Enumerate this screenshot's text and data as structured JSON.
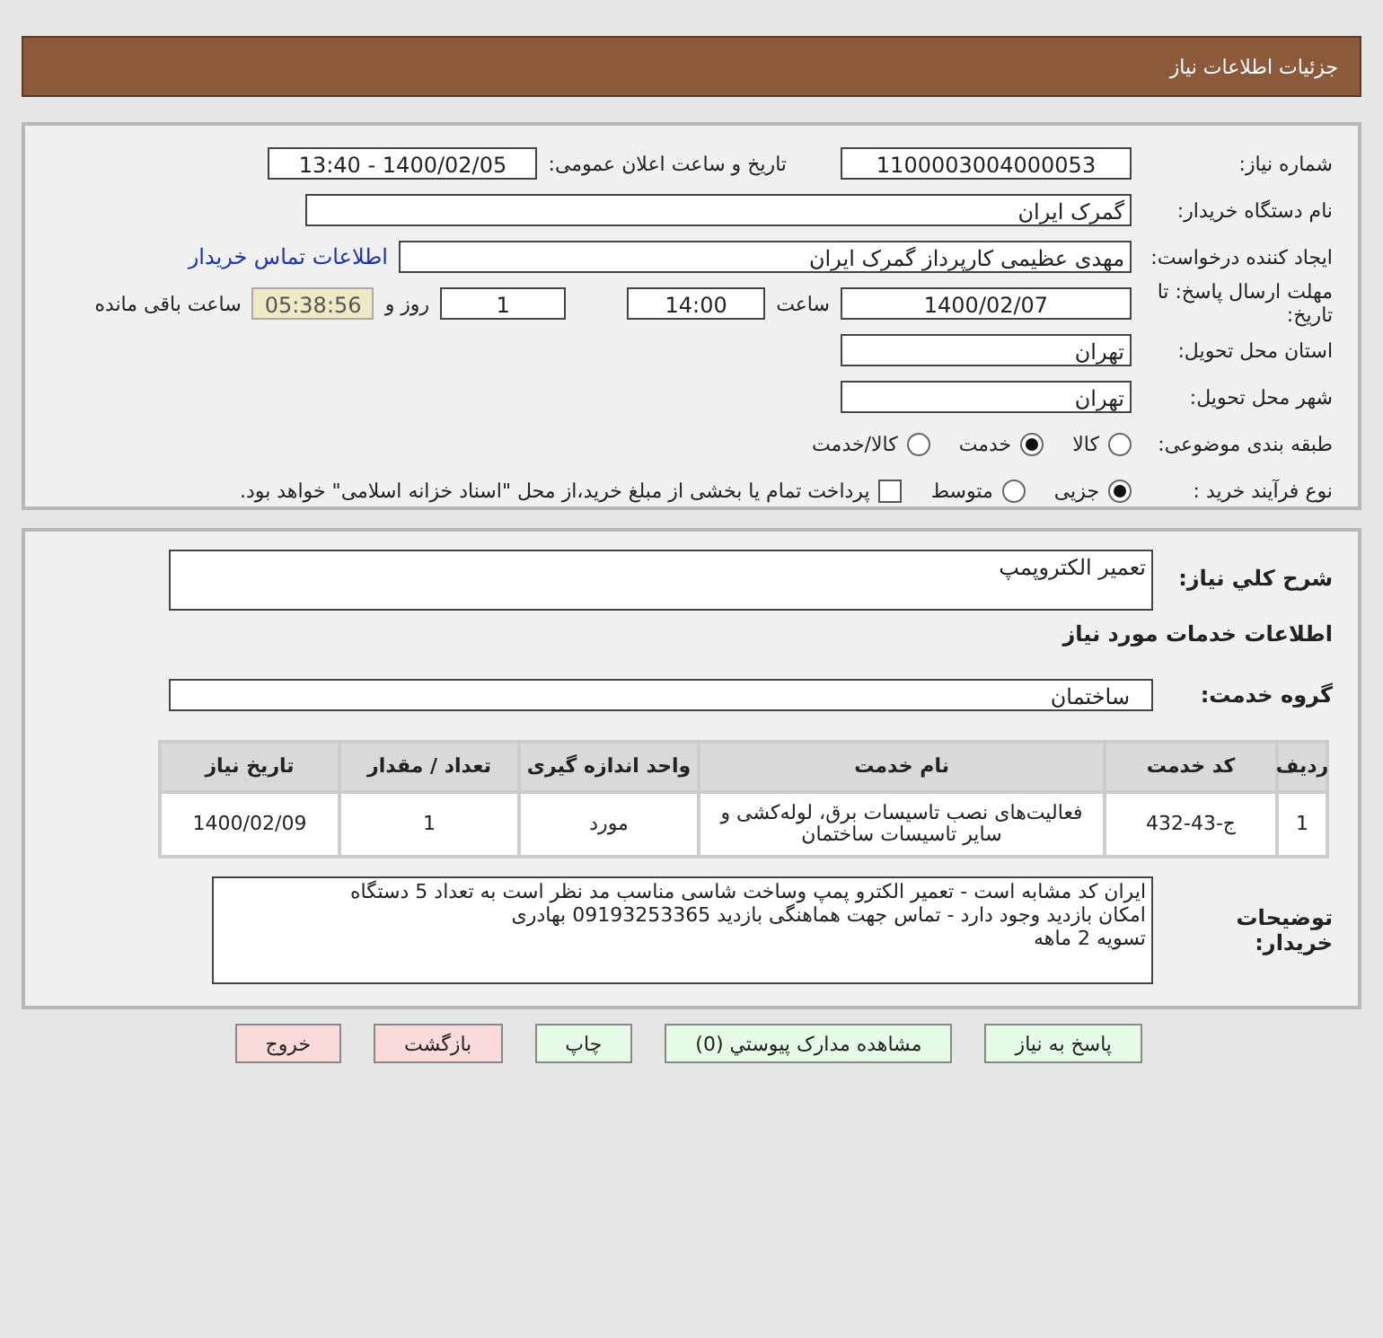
{
  "header": {
    "title": "جزئیات اطلاعات نیاز"
  },
  "info": {
    "need_number": {
      "label": "شماره نیاز:",
      "value": "1100003004000053"
    },
    "announce": {
      "label": "تاریخ و ساعت اعلان عمومی:",
      "value": "1400/02/05 - 13:40"
    },
    "buyer_org": {
      "label": "نام دستگاه خریدار:",
      "value": "گمرک ایران"
    },
    "requester": {
      "label": "ایجاد کننده درخواست:",
      "value": "مهدی عظیمی کارپرداز گمرک ایران",
      "link": "اطلاعات تماس خریدار"
    },
    "deadline": {
      "label": "مهلت ارسال پاسخ: تا تاریخ:",
      "date": "1400/02/07",
      "time_label": "ساعت",
      "time": "14:00",
      "days": "1",
      "days_label": "روز و",
      "remaining": "05:38:56",
      "remaining_label": "ساعت باقی مانده"
    },
    "province": {
      "label": "استان محل تحویل:",
      "value": "تهران"
    },
    "city": {
      "label": "شهر محل تحویل:",
      "value": "تهران"
    },
    "category": {
      "label": "طبقه بندی موضوعی:",
      "options": [
        {
          "label": "کالا",
          "selected": false
        },
        {
          "label": "خدمت",
          "selected": true
        },
        {
          "label": "کالا/خدمت",
          "selected": false
        }
      ]
    },
    "process": {
      "label": "نوع فرآیند خرید :",
      "options": [
        {
          "label": "جزیی",
          "selected": true
        },
        {
          "label": "متوسط",
          "selected": false
        }
      ],
      "payment": {
        "label": "پرداخت تمام یا بخشی از مبلغ خرید،از محل \"اسناد خزانه اسلامی\" خواهد بود.",
        "checked": false
      }
    }
  },
  "details": {
    "description": {
      "label": "شرح كلي نياز:",
      "value": "تعمیر الکتروپمپ"
    },
    "services_heading": "اطلاعات خدمات مورد نیاز",
    "service_group": {
      "label": "گروه خدمت:",
      "value": "ساختمان"
    },
    "table": {
      "columns": [
        "ردیف",
        "کد خدمت",
        "نام خدمت",
        "واحد اندازه گیری",
        "تعداد / مقدار",
        "تاریخ نیاز"
      ],
      "rows": [
        [
          "1",
          "ج-43-432",
          "فعالیت‌های نصب تاسیسات برق، لوله‌کشی و سایر تاسیسات ساختمان",
          "مورد",
          "1",
          "1400/02/09"
        ]
      ]
    },
    "buyer_notes": {
      "label": "توضیحات خریدار:",
      "lines": [
        "ایران کد مشابه است - تعمیر الکترو پمپ وساخت شاسی مناسب مد نظر است به تعداد 5 دستگاه",
        "امکان بازدید وجود دارد - تماس جهت هماهنگی بازدید 09193253365 بهادری",
        "تسویه 2 ماهه"
      ]
    }
  },
  "buttons": [
    {
      "label": "پاسخ به نیاز",
      "kind": "normal"
    },
    {
      "label": "مشاهده مدارک پیوستي (0)",
      "kind": "normal"
    },
    {
      "label": "چاپ",
      "kind": "normal"
    },
    {
      "label": "بازگشت",
      "kind": "danger"
    },
    {
      "label": "خروج",
      "kind": "danger"
    }
  ]
}
